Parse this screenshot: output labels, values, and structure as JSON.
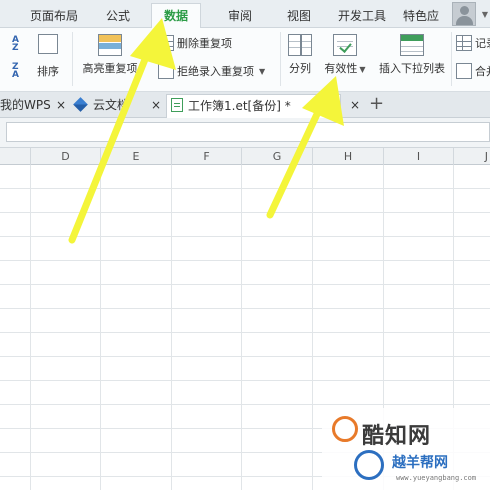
{
  "menu": {
    "items": [
      "页面布局",
      "公式",
      "数据",
      "审阅",
      "视图",
      "开发工具",
      "特色应"
    ],
    "active": "数据"
  },
  "ribbon": {
    "sort_label": "排序",
    "highlight_label": "高亮重复项",
    "delete_dup_label": "删除重复项",
    "reject_dup_label": "拒绝录入重复项",
    "split_label": "分列",
    "validity_label": "有效性",
    "insert_dropdown_label": "插入下拉列表",
    "record_label": "记录",
    "merge_label": "合并"
  },
  "doc_tabs": {
    "home_label": "我的WPS",
    "cloud_label": "云文档",
    "active_label": "工作簿1.et[备份] *",
    "close_glyph": "×",
    "new_glyph": "+"
  },
  "sheet": {
    "columns": [
      "D",
      "E",
      "F",
      "G",
      "H",
      "I",
      "J"
    ]
  },
  "watermark": {
    "main": "酷知网",
    "sub": "越羊帮网",
    "url": "www.yueyangbang.com"
  },
  "colors": {
    "accent_green": "#2d9c47",
    "arrow_yellow": "#f4f53a",
    "ribbon_bg": "#fafcfd",
    "menubar_bg": "#e9eef2"
  },
  "icons": [
    "sort-icon",
    "highlight-duplicates-icon",
    "delete-duplicates-icon",
    "reject-duplicates-icon",
    "split-columns-icon",
    "validity-icon",
    "insert-dropdown-icon",
    "record-icon",
    "merge-icon",
    "user-avatar-icon",
    "cloud-doc-icon",
    "sheet-file-icon"
  ]
}
